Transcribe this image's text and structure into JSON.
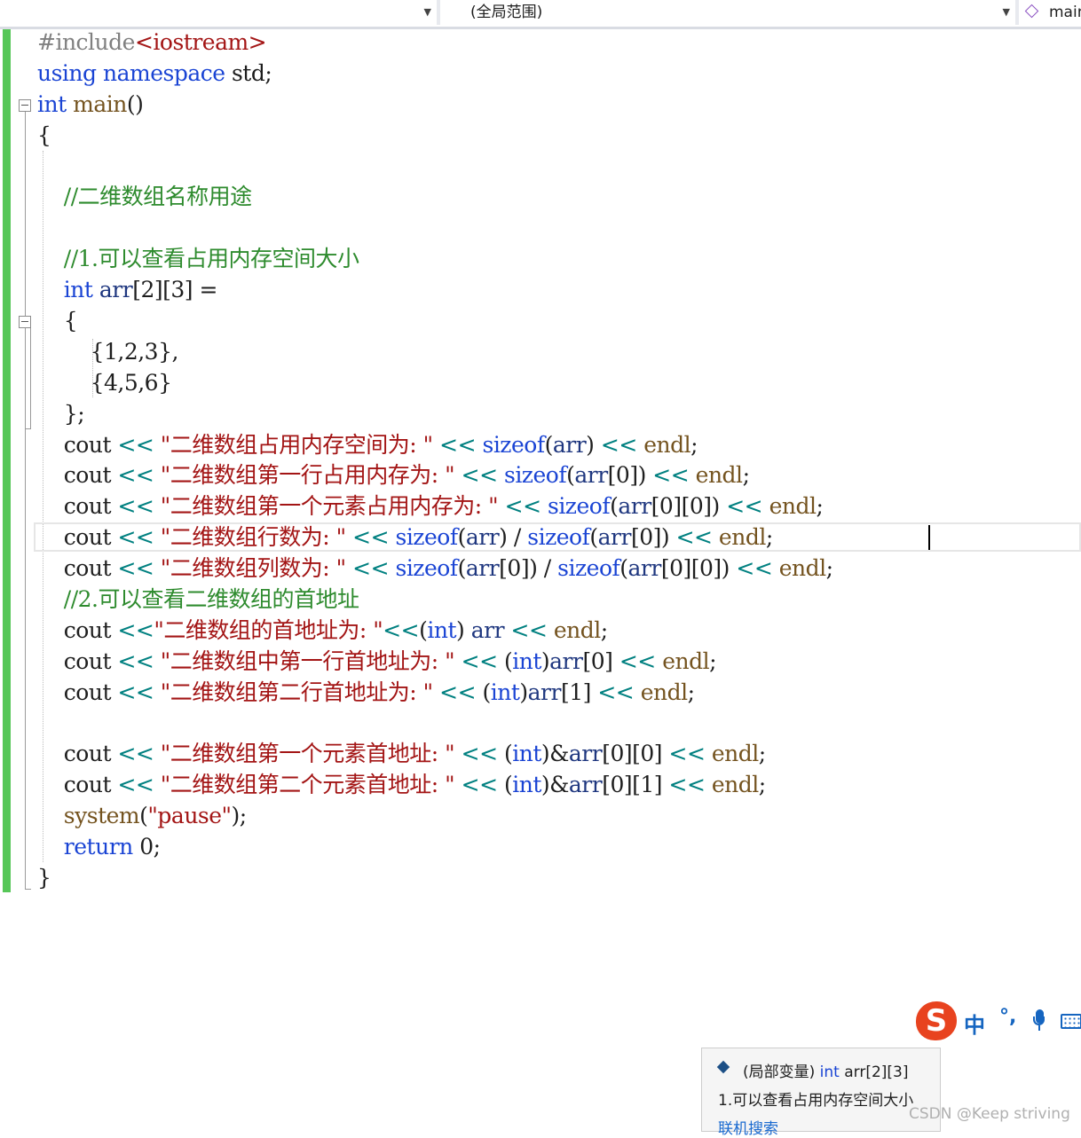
{
  "nav": {
    "scope_label": "(全局范围)",
    "function_label": "main"
  },
  "code_lines": [
    [
      [
        "pp",
        "#include"
      ],
      [
        "st",
        "<iostream>"
      ]
    ],
    [
      [
        "kw",
        "using"
      ],
      [
        "tx",
        " "
      ],
      [
        "kw",
        "namespace"
      ],
      [
        "tx",
        " std;"
      ]
    ],
    [
      [
        "kw",
        "int"
      ],
      [
        "tx",
        " "
      ],
      [
        "fn",
        "main"
      ],
      [
        "tx",
        "()"
      ]
    ],
    [
      [
        "tx",
        "{"
      ]
    ],
    [
      [
        "tx",
        ""
      ]
    ],
    [
      [
        "tx",
        "    "
      ],
      [
        "cm",
        "//二维数组名称用途"
      ]
    ],
    [
      [
        "tx",
        ""
      ]
    ],
    [
      [
        "tx",
        "    "
      ],
      [
        "cm",
        "//1.可以查看占用内存空间大小"
      ]
    ],
    [
      [
        "tx",
        "    "
      ],
      [
        "kw",
        "int"
      ],
      [
        "tx",
        " "
      ],
      [
        "id",
        "arr"
      ],
      [
        "tx",
        "[2][3] ="
      ]
    ],
    [
      [
        "tx",
        "    {"
      ]
    ],
    [
      [
        "tx",
        "        {1,2,3},"
      ]
    ],
    [
      [
        "tx",
        "        {4,5,6}"
      ]
    ],
    [
      [
        "tx",
        "    };"
      ]
    ],
    [
      [
        "tx",
        "    cout "
      ],
      [
        "op",
        "<<"
      ],
      [
        "tx",
        " "
      ],
      [
        "st",
        "\"二维数组占用内存空间为: \""
      ],
      [
        "tx",
        " "
      ],
      [
        "op",
        "<<"
      ],
      [
        "tx",
        " "
      ],
      [
        "kw",
        "sizeof"
      ],
      [
        "tx",
        "("
      ],
      [
        "id",
        "arr"
      ],
      [
        "tx",
        ") "
      ],
      [
        "op",
        "<<"
      ],
      [
        "tx",
        " "
      ],
      [
        "fn",
        "endl"
      ],
      [
        "tx",
        ";"
      ]
    ],
    [
      [
        "tx",
        "    cout "
      ],
      [
        "op",
        "<<"
      ],
      [
        "tx",
        " "
      ],
      [
        "st",
        "\"二维数组第一行占用内存为: \""
      ],
      [
        "tx",
        " "
      ],
      [
        "op",
        "<<"
      ],
      [
        "tx",
        " "
      ],
      [
        "kw",
        "sizeof"
      ],
      [
        "tx",
        "("
      ],
      [
        "id",
        "arr"
      ],
      [
        "tx",
        "[0]) "
      ],
      [
        "op",
        "<<"
      ],
      [
        "tx",
        " "
      ],
      [
        "fn",
        "endl"
      ],
      [
        "tx",
        ";"
      ]
    ],
    [
      [
        "tx",
        "    cout "
      ],
      [
        "op",
        "<<"
      ],
      [
        "tx",
        " "
      ],
      [
        "st",
        "\"二维数组第一个元素占用内存为: \""
      ],
      [
        "tx",
        " "
      ],
      [
        "op",
        "<<"
      ],
      [
        "tx",
        " "
      ],
      [
        "kw",
        "sizeof"
      ],
      [
        "tx",
        "("
      ],
      [
        "id",
        "arr"
      ],
      [
        "tx",
        "[0][0]) "
      ],
      [
        "op",
        "<<"
      ],
      [
        "tx",
        " "
      ],
      [
        "fn",
        "endl"
      ],
      [
        "tx",
        ";"
      ]
    ],
    [
      [
        "tx",
        "    cout "
      ],
      [
        "op",
        "<<"
      ],
      [
        "tx",
        " "
      ],
      [
        "st",
        "\"二维数组行数为: \""
      ],
      [
        "tx",
        " "
      ],
      [
        "op",
        "<<"
      ],
      [
        "tx",
        " "
      ],
      [
        "kw",
        "sizeof"
      ],
      [
        "tx",
        "("
      ],
      [
        "id",
        "arr"
      ],
      [
        "tx",
        ") / "
      ],
      [
        "kw",
        "sizeof"
      ],
      [
        "tx",
        "("
      ],
      [
        "id",
        "arr"
      ],
      [
        "tx",
        "[0]) "
      ],
      [
        "op",
        "<<"
      ],
      [
        "tx",
        " "
      ],
      [
        "fn",
        "endl"
      ],
      [
        "tx",
        ";"
      ]
    ],
    [
      [
        "tx",
        "    cout "
      ],
      [
        "op",
        "<<"
      ],
      [
        "tx",
        " "
      ],
      [
        "st",
        "\"二维数组列数为: \""
      ],
      [
        "tx",
        " "
      ],
      [
        "op",
        "<<"
      ],
      [
        "tx",
        " "
      ],
      [
        "kw",
        "sizeof"
      ],
      [
        "tx",
        "("
      ],
      [
        "id",
        "arr"
      ],
      [
        "tx",
        "[0]) / "
      ],
      [
        "kw",
        "sizeof"
      ],
      [
        "tx",
        "("
      ],
      [
        "id",
        "arr"
      ],
      [
        "tx",
        "[0][0]) "
      ],
      [
        "op",
        "<<"
      ],
      [
        "tx",
        " "
      ],
      [
        "fn",
        "endl"
      ],
      [
        "tx",
        ";"
      ]
    ],
    [
      [
        "tx",
        "    "
      ],
      [
        "cm",
        "//2.可以查看二维数组的首地址"
      ]
    ],
    [
      [
        "tx",
        "    cout "
      ],
      [
        "op",
        "<<"
      ],
      [
        "st",
        "\"二维数组的首地址为: \""
      ],
      [
        "op",
        "<<"
      ],
      [
        "tx",
        "("
      ],
      [
        "kw",
        "int"
      ],
      [
        "tx",
        ") "
      ],
      [
        "id",
        "arr"
      ],
      [
        "tx",
        " "
      ],
      [
        "op",
        "<<"
      ],
      [
        "tx",
        " "
      ],
      [
        "fn",
        "endl"
      ],
      [
        "tx",
        ";"
      ]
    ],
    [
      [
        "tx",
        "    cout "
      ],
      [
        "op",
        "<<"
      ],
      [
        "tx",
        " "
      ],
      [
        "st",
        "\"二维数组中第一行首地址为: \""
      ],
      [
        "tx",
        " "
      ],
      [
        "op",
        "<<"
      ],
      [
        "tx",
        " ("
      ],
      [
        "kw",
        "int"
      ],
      [
        "tx",
        ")"
      ],
      [
        "id",
        "arr"
      ],
      [
        "tx",
        "[0] "
      ],
      [
        "op",
        "<<"
      ],
      [
        "tx",
        " "
      ],
      [
        "fn",
        "endl"
      ],
      [
        "tx",
        ";"
      ]
    ],
    [
      [
        "tx",
        "    cout "
      ],
      [
        "op",
        "<<"
      ],
      [
        "tx",
        " "
      ],
      [
        "st",
        "\"二维数组第二行首地址为: \""
      ],
      [
        "tx",
        " "
      ],
      [
        "op",
        "<<"
      ],
      [
        "tx",
        " ("
      ],
      [
        "kw",
        "int"
      ],
      [
        "tx",
        ")"
      ],
      [
        "id",
        "arr"
      ],
      [
        "tx",
        "[1] "
      ],
      [
        "op",
        "<<"
      ],
      [
        "tx",
        " "
      ],
      [
        "fn",
        "endl"
      ],
      [
        "tx",
        ";"
      ]
    ],
    [
      [
        "tx",
        ""
      ]
    ],
    [
      [
        "tx",
        "    cout "
      ],
      [
        "op",
        "<<"
      ],
      [
        "tx",
        " "
      ],
      [
        "st",
        "\"二维数组第一个元素首地址: \""
      ],
      [
        "tx",
        " "
      ],
      [
        "op",
        "<<"
      ],
      [
        "tx",
        " ("
      ],
      [
        "kw",
        "int"
      ],
      [
        "tx",
        ")&"
      ],
      [
        "id",
        "arr"
      ],
      [
        "tx",
        "[0][0] "
      ],
      [
        "op",
        "<<"
      ],
      [
        "tx",
        " "
      ],
      [
        "fn",
        "endl"
      ],
      [
        "tx",
        ";"
      ]
    ],
    [
      [
        "tx",
        "    cout "
      ],
      [
        "op",
        "<<"
      ],
      [
        "tx",
        " "
      ],
      [
        "st",
        "\"二维数组第二个元素首地址: \""
      ],
      [
        "tx",
        " "
      ],
      [
        "op",
        "<<"
      ],
      [
        "tx",
        " ("
      ],
      [
        "kw",
        "int"
      ],
      [
        "tx",
        ")&"
      ],
      [
        "id",
        "arr"
      ],
      [
        "tx",
        "[0][1] "
      ],
      [
        "op",
        "<<"
      ],
      [
        "tx",
        " "
      ],
      [
        "fn",
        "endl"
      ],
      [
        "tx",
        ";"
      ]
    ],
    [
      [
        "tx",
        "    "
      ],
      [
        "fn",
        "system"
      ],
      [
        "tx",
        "("
      ],
      [
        "st",
        "\"pause\""
      ],
      [
        "tx",
        ");"
      ]
    ],
    [
      [
        "tx",
        "    "
      ],
      [
        "kw",
        "return"
      ],
      [
        "tx",
        " 0;"
      ]
    ],
    [
      [
        "tx",
        "}"
      ]
    ]
  ],
  "current_line_index": 16,
  "ime": {
    "logo_letter": "S",
    "mode_label": "中",
    "punct_label": "°,"
  },
  "tooltip": {
    "category": "(局部变量) ",
    "type": "int",
    "declaration": " arr[2][3]",
    "comment": "1.可以查看占用内存空间大小",
    "link": "联机搜索"
  },
  "watermark": "CSDN @Keep striving"
}
